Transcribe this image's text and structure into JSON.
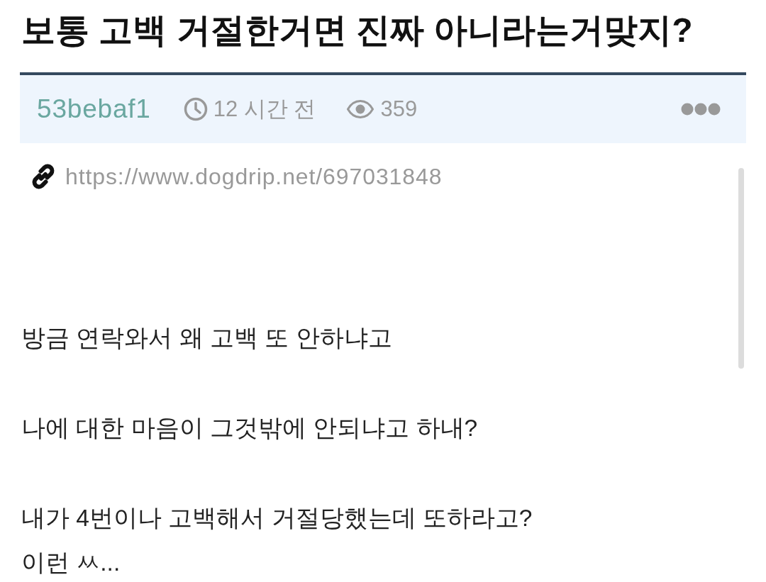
{
  "title": "보통 고백 거절한거면 진짜 아니라는거맞지?",
  "meta": {
    "author": "53bebaf1",
    "time": "12 시간 전",
    "views": "359"
  },
  "link": {
    "url": "https://www.dogdrip.net/697031848"
  },
  "body": {
    "paragraphs": [
      "방금 연락와서 왜 고백 또 안하냐고",
      "나에 대한 마음이 그것밖에 안되냐고 하내?",
      "내가 4번이나 고백해서 거절당했는데 또하라고?\n이런 ㅆ..."
    ]
  }
}
